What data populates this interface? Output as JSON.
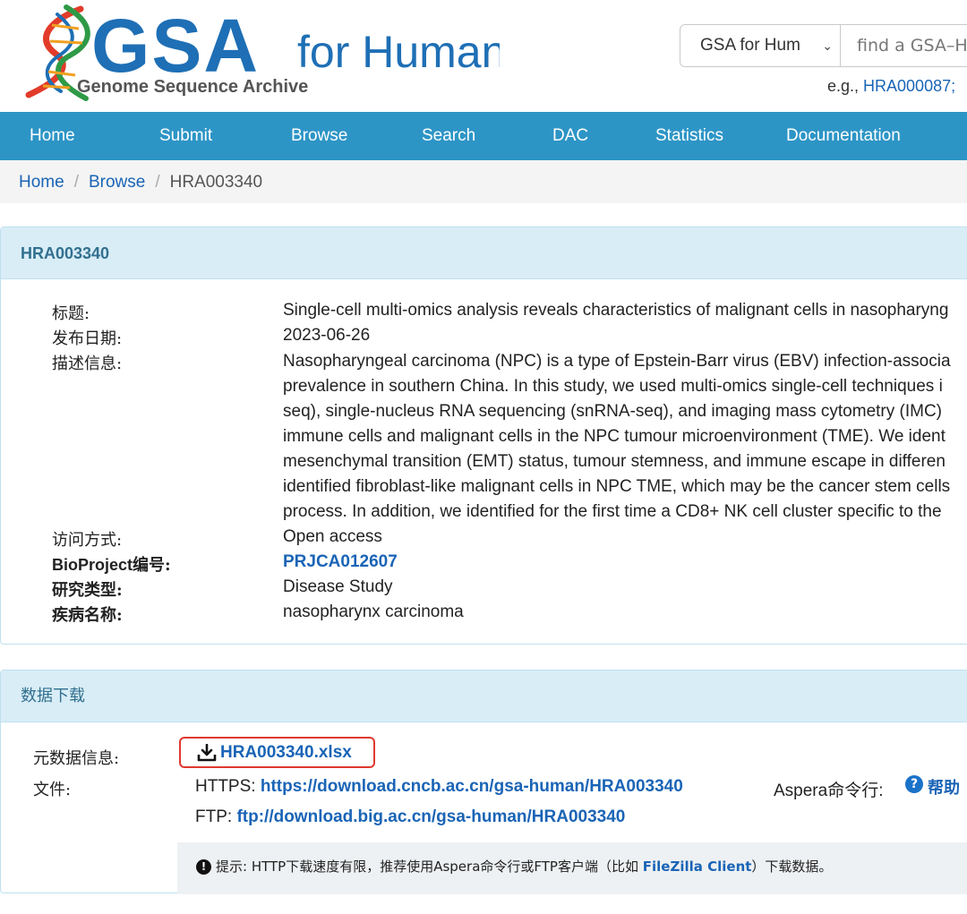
{
  "header": {
    "logo_main": "GSA",
    "logo_suffix": "for Human",
    "logo_subtitle": "Genome Sequence Archive",
    "search_select_value": "GSA for Hum",
    "search_placeholder": "find a GSA–H",
    "example_prefix": "e.g., ",
    "example_link": "HRA000087;"
  },
  "nav": {
    "items": [
      "Home",
      "Submit",
      "Browse",
      "Search",
      "DAC",
      "Statistics",
      "Documentation"
    ]
  },
  "breadcrumb": {
    "home": "Home",
    "sep": "/",
    "browse": "Browse",
    "current": "HRA003340"
  },
  "record": {
    "title": "HRA003340",
    "fields": {
      "title_label": "标题:",
      "title_value": "Single-cell multi-omics analysis reveals characteristics of malignant cells in nasopharyng",
      "date_label": "发布日期:",
      "date_value": "2023-06-26",
      "desc_label": "描述信息:",
      "desc_lines": [
        "Nasopharyngeal carcinoma (NPC) is a type of Epstein-Barr virus (EBV) infection-associa",
        "prevalence in southern China. In this study, we used multi-omics single-cell techniques i",
        "seq), single-nucleus RNA sequencing (snRNA-seq), and imaging mass cytometry (IMC)",
        "immune cells and malignant cells in the NPC tumour microenvironment (TME). We ident",
        "mesenchymal transition (EMT) status, tumour stemness, and immune escape in differen",
        "identified fibroblast-like malignant cells in NPC TME, which may be the cancer stem cells",
        "process. In addition, we identified for the first time a CD8+ NK cell cluster specific to the"
      ],
      "access_label": "访问方式:",
      "access_value": "Open access",
      "bioproject_label_prefix": "BioProject",
      "bioproject_label_suffix": "编号:",
      "bioproject_value": "PRJCA012607",
      "study_type_label": "研究类型:",
      "study_type_value": "Disease Study",
      "disease_label": "疾病名称:",
      "disease_value": "nasopharynx carcinoma"
    }
  },
  "download": {
    "title": "数据下载",
    "metadata_label": "元数据信息:",
    "metadata_file": "HRA003340.xlsx",
    "files_label": "文件:",
    "https_label": "HTTPS: ",
    "https_link": "https://download.cncb.ac.cn/gsa-human/HRA003340",
    "ftp_label": "FTP: ",
    "ftp_link": "ftp://download.big.ac.cn/gsa-human/HRA003340",
    "aspera_label": "Aspera命令行:",
    "help_label": "帮助",
    "tip_prefix": "提示: HTTP下载速度有限，推荐使用Aspera命令行或FTP客户端（比如 ",
    "tip_link": "FileZilla Client",
    "tip_suffix": "）下载数据。"
  },
  "colors": {
    "nav_bg": "#2d95c6",
    "panel_head_bg": "#d9edf7",
    "link": "#1a64b6",
    "highlight_border": "#e0382f",
    "logo_blue": "#1e6fb5"
  }
}
